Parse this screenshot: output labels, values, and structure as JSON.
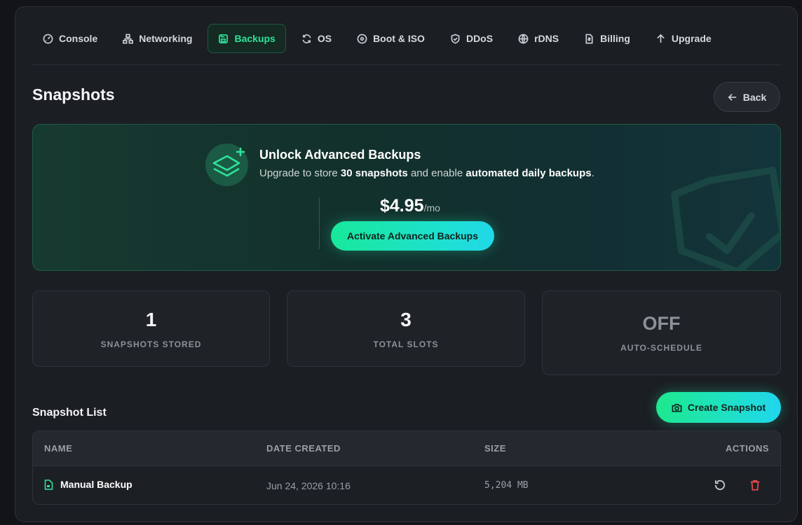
{
  "tabs": [
    {
      "label": "Console",
      "icon": "gauge-icon",
      "active": false
    },
    {
      "label": "Networking",
      "icon": "network-icon",
      "active": false
    },
    {
      "label": "Backups",
      "icon": "save-icon",
      "active": true
    },
    {
      "label": "OS",
      "icon": "refresh-icon",
      "active": false
    },
    {
      "label": "Boot & ISO",
      "icon": "disc-icon",
      "active": false
    },
    {
      "label": "DDoS",
      "icon": "shield-icon",
      "active": false
    },
    {
      "label": "rDNS",
      "icon": "globe-icon",
      "active": false
    },
    {
      "label": "Billing",
      "icon": "receipt-icon",
      "active": false
    },
    {
      "label": "Upgrade",
      "icon": "arrow-up-icon",
      "active": false
    }
  ],
  "page": {
    "title": "Snapshots",
    "back_label": "Back"
  },
  "promo": {
    "title": "Unlock Advanced Backups",
    "sub_prefix": "Upgrade to store ",
    "sub_bold1": "30 snapshots",
    "sub_mid": " and enable ",
    "sub_bold2": "automated daily backups",
    "sub_suffix": ".",
    "price": "$4.95",
    "price_unit": "/mo",
    "cta": "Activate Advanced Backups",
    "accent": "#18e89a"
  },
  "stats": [
    {
      "value": "1",
      "label": "SNAPSHOTS STORED"
    },
    {
      "value": "3",
      "label": "TOTAL SLOTS"
    },
    {
      "value": "OFF",
      "label": "AUTO-SCHEDULE"
    }
  ],
  "list": {
    "title": "Snapshot List",
    "create_label": "Create Snapshot",
    "columns": [
      "NAME",
      "DATE CREATED",
      "SIZE",
      "ACTIONS"
    ],
    "rows": [
      {
        "name": "Manual Backup",
        "date": "Jun 24, 2026 10:16",
        "size": "5,204 MB"
      }
    ]
  },
  "colors": {
    "accent": "#2ee29a",
    "danger": "#e5484d",
    "background": "#1b1e23"
  }
}
